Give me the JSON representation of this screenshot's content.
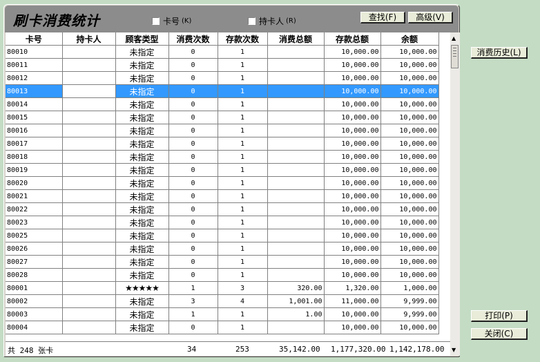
{
  "title": "刷卡消费统计",
  "filters": {
    "card_no_label": "卡号",
    "card_no_key": "(K)",
    "holder_label": "持卡人",
    "holder_key": "(R)"
  },
  "toolbar": {
    "find_label": "查找(F)",
    "advanced_label": "高级(V)"
  },
  "side_buttons": {
    "history_label": "消费历史(L)",
    "print_label": "打印(P)",
    "close_label": "关闭(C)"
  },
  "columns": [
    "卡号",
    "持卡人",
    "顾客类型",
    "消费次数",
    "存款次数",
    "消费总额",
    "存款总额",
    "余额"
  ],
  "rows": [
    {
      "id": "80010",
      "holder": "",
      "type": "未指定",
      "spend_count": "0",
      "deposit_count": "1",
      "spend_total": "",
      "deposit_total": "10,000.00",
      "balance": "10,000.00"
    },
    {
      "id": "80011",
      "holder": "",
      "type": "未指定",
      "spend_count": "0",
      "deposit_count": "1",
      "spend_total": "",
      "deposit_total": "10,000.00",
      "balance": "10,000.00"
    },
    {
      "id": "80012",
      "holder": "",
      "type": "未指定",
      "spend_count": "0",
      "deposit_count": "1",
      "spend_total": "",
      "deposit_total": "10,000.00",
      "balance": "10,000.00"
    },
    {
      "id": "80013",
      "holder": "",
      "type": "未指定",
      "spend_count": "0",
      "deposit_count": "1",
      "spend_total": "",
      "deposit_total": "10,000.00",
      "balance": "10,000.00",
      "selected": true
    },
    {
      "id": "80014",
      "holder": "",
      "type": "未指定",
      "spend_count": "0",
      "deposit_count": "1",
      "spend_total": "",
      "deposit_total": "10,000.00",
      "balance": "10,000.00"
    },
    {
      "id": "80015",
      "holder": "",
      "type": "未指定",
      "spend_count": "0",
      "deposit_count": "1",
      "spend_total": "",
      "deposit_total": "10,000.00",
      "balance": "10,000.00"
    },
    {
      "id": "80016",
      "holder": "",
      "type": "未指定",
      "spend_count": "0",
      "deposit_count": "1",
      "spend_total": "",
      "deposit_total": "10,000.00",
      "balance": "10,000.00"
    },
    {
      "id": "80017",
      "holder": "",
      "type": "未指定",
      "spend_count": "0",
      "deposit_count": "1",
      "spend_total": "",
      "deposit_total": "10,000.00",
      "balance": "10,000.00"
    },
    {
      "id": "80018",
      "holder": "",
      "type": "未指定",
      "spend_count": "0",
      "deposit_count": "1",
      "spend_total": "",
      "deposit_total": "10,000.00",
      "balance": "10,000.00"
    },
    {
      "id": "80019",
      "holder": "",
      "type": "未指定",
      "spend_count": "0",
      "deposit_count": "1",
      "spend_total": "",
      "deposit_total": "10,000.00",
      "balance": "10,000.00"
    },
    {
      "id": "80020",
      "holder": "",
      "type": "未指定",
      "spend_count": "0",
      "deposit_count": "1",
      "spend_total": "",
      "deposit_total": "10,000.00",
      "balance": "10,000.00"
    },
    {
      "id": "80021",
      "holder": "",
      "type": "未指定",
      "spend_count": "0",
      "deposit_count": "1",
      "spend_total": "",
      "deposit_total": "10,000.00",
      "balance": "10,000.00"
    },
    {
      "id": "80022",
      "holder": "",
      "type": "未指定",
      "spend_count": "0",
      "deposit_count": "1",
      "spend_total": "",
      "deposit_total": "10,000.00",
      "balance": "10,000.00"
    },
    {
      "id": "80023",
      "holder": "",
      "type": "未指定",
      "spend_count": "0",
      "deposit_count": "1",
      "spend_total": "",
      "deposit_total": "10,000.00",
      "balance": "10,000.00"
    },
    {
      "id": "80025",
      "holder": "",
      "type": "未指定",
      "spend_count": "0",
      "deposit_count": "1",
      "spend_total": "",
      "deposit_total": "10,000.00",
      "balance": "10,000.00"
    },
    {
      "id": "80026",
      "holder": "",
      "type": "未指定",
      "spend_count": "0",
      "deposit_count": "1",
      "spend_total": "",
      "deposit_total": "10,000.00",
      "balance": "10,000.00"
    },
    {
      "id": "80027",
      "holder": "",
      "type": "未指定",
      "spend_count": "0",
      "deposit_count": "1",
      "spend_total": "",
      "deposit_total": "10,000.00",
      "balance": "10,000.00"
    },
    {
      "id": "80028",
      "holder": "",
      "type": "未指定",
      "spend_count": "0",
      "deposit_count": "1",
      "spend_total": "",
      "deposit_total": "10,000.00",
      "balance": "10,000.00"
    },
    {
      "id": "80001",
      "holder": "",
      "type": "★★★★★",
      "spend_count": "1",
      "deposit_count": "3",
      "spend_total": "320.00",
      "deposit_total": "1,320.00",
      "balance": "1,000.00"
    },
    {
      "id": "80002",
      "holder": "",
      "type": "未指定",
      "spend_count": "3",
      "deposit_count": "4",
      "spend_total": "1,001.00",
      "deposit_total": "11,000.00",
      "balance": "9,999.00"
    },
    {
      "id": "80003",
      "holder": "",
      "type": "未指定",
      "spend_count": "1",
      "deposit_count": "1",
      "spend_total": "1.00",
      "deposit_total": "10,000.00",
      "balance": "9,999.00"
    },
    {
      "id": "80004",
      "holder": "",
      "type": "未指定",
      "spend_count": "0",
      "deposit_count": "1",
      "spend_total": "",
      "deposit_total": "10,000.00",
      "balance": "10,000.00"
    }
  ],
  "totals": {
    "card_summary": "共 248 张卡",
    "spend_count": "34",
    "deposit_count": "253",
    "spend_total": "35,142.00",
    "deposit_total": "1,177,320.00",
    "balance": "1,142,178.00"
  },
  "colors": {
    "background": "#c4dcc4",
    "panel": "#d4d0c8",
    "selection": "#3399ff",
    "title_bar": "#8c8c8c"
  }
}
